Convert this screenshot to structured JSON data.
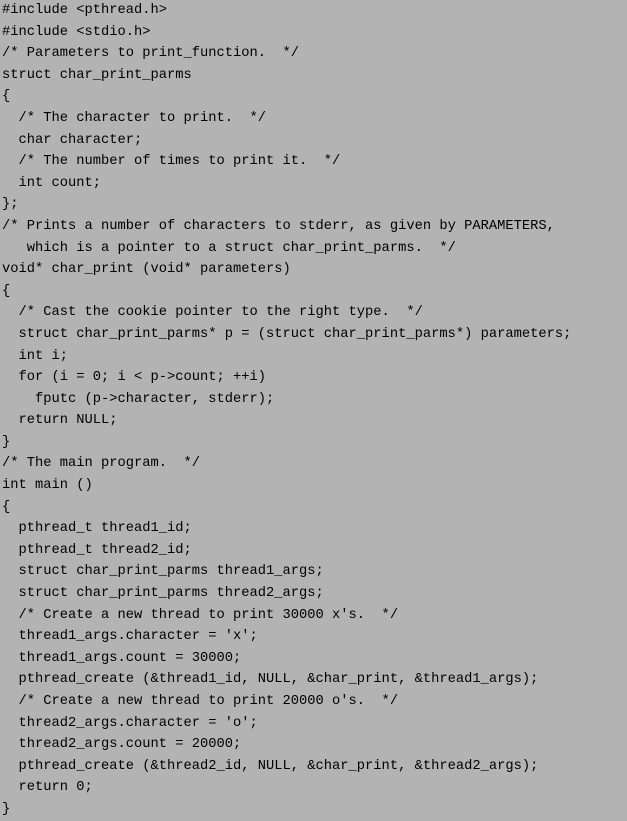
{
  "code_lines": [
    "#include <pthread.h>",
    "#include <stdio.h>",
    "/* Parameters to print_function.  */",
    "struct char_print_parms",
    "{",
    "  /* The character to print.  */",
    "  char character;",
    "  /* The number of times to print it.  */",
    "  int count;",
    "};",
    "/* Prints a number of characters to stderr, as given by PARAMETERS,",
    "   which is a pointer to a struct char_print_parms.  */",
    "void* char_print (void* parameters)",
    "{",
    "  /* Cast the cookie pointer to the right type.  */",
    "  struct char_print_parms* p = (struct char_print_parms*) parameters;",
    "  int i;",
    "  for (i = 0; i < p->count; ++i)",
    "    fputc (p->character, stderr);",
    "  return NULL;",
    "}",
    "/* The main program.  */",
    "int main ()",
    "{",
    "  pthread_t thread1_id;",
    "  pthread_t thread2_id;",
    "  struct char_print_parms thread1_args;",
    "  struct char_print_parms thread2_args;",
    "  /* Create a new thread to print 30000 x's.  */",
    "  thread1_args.character = 'x';",
    "  thread1_args.count = 30000;",
    "  pthread_create (&thread1_id, NULL, &char_print, &thread1_args);",
    "  /* Create a new thread to print 20000 o's.  */",
    "  thread2_args.character = 'o';",
    "  thread2_args.count = 20000;",
    "  pthread_create (&thread2_id, NULL, &char_print, &thread2_args);",
    "  return 0;",
    "}"
  ]
}
